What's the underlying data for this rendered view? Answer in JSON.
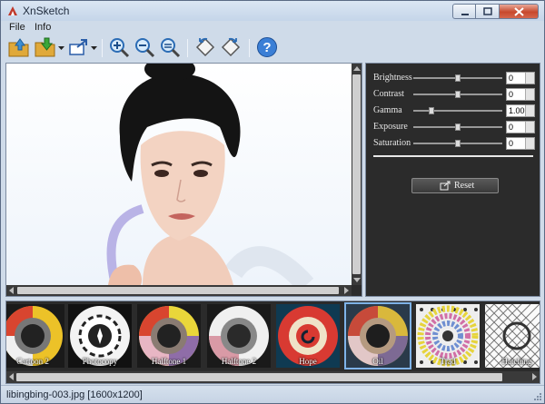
{
  "window": {
    "title": "XnSketch"
  },
  "menu": {
    "items": [
      {
        "label": "File"
      },
      {
        "label": "Info"
      }
    ]
  },
  "toolbar": {
    "icons": [
      "open-folder-icon",
      "save-folder-icon",
      "export-icon",
      "zoom-in-icon",
      "zoom-out-icon",
      "zoom-fit-icon",
      "rotate-left-icon",
      "rotate-right-icon",
      "help-icon"
    ]
  },
  "parameters": [
    {
      "label": "Brightness",
      "value": "0",
      "level": 0.5
    },
    {
      "label": "Contrast",
      "value": "0",
      "level": 0.5
    },
    {
      "label": "Gamma",
      "value": "1.00",
      "level": 0.2
    },
    {
      "label": "Exposure",
      "value": "0",
      "level": 0.5
    },
    {
      "label": "Saturation",
      "value": "0",
      "level": 0.5
    }
  ],
  "reset": {
    "label": "Reset"
  },
  "filters": [
    {
      "label": "Cartoon 2"
    },
    {
      "label": "Photocopy"
    },
    {
      "label": "Halftone 1"
    },
    {
      "label": "Halftone 2"
    },
    {
      "label": "Hope"
    },
    {
      "label": "Oil",
      "selected": true
    },
    {
      "label": "Trad"
    },
    {
      "label": "Hatching"
    }
  ],
  "status": {
    "text": "libingbing-003.jpg [1600x1200]"
  },
  "colors": {
    "panel_bg": "#2b2b2b",
    "window_bg": "#cfdbe9",
    "selection": "#7fb3e8"
  }
}
